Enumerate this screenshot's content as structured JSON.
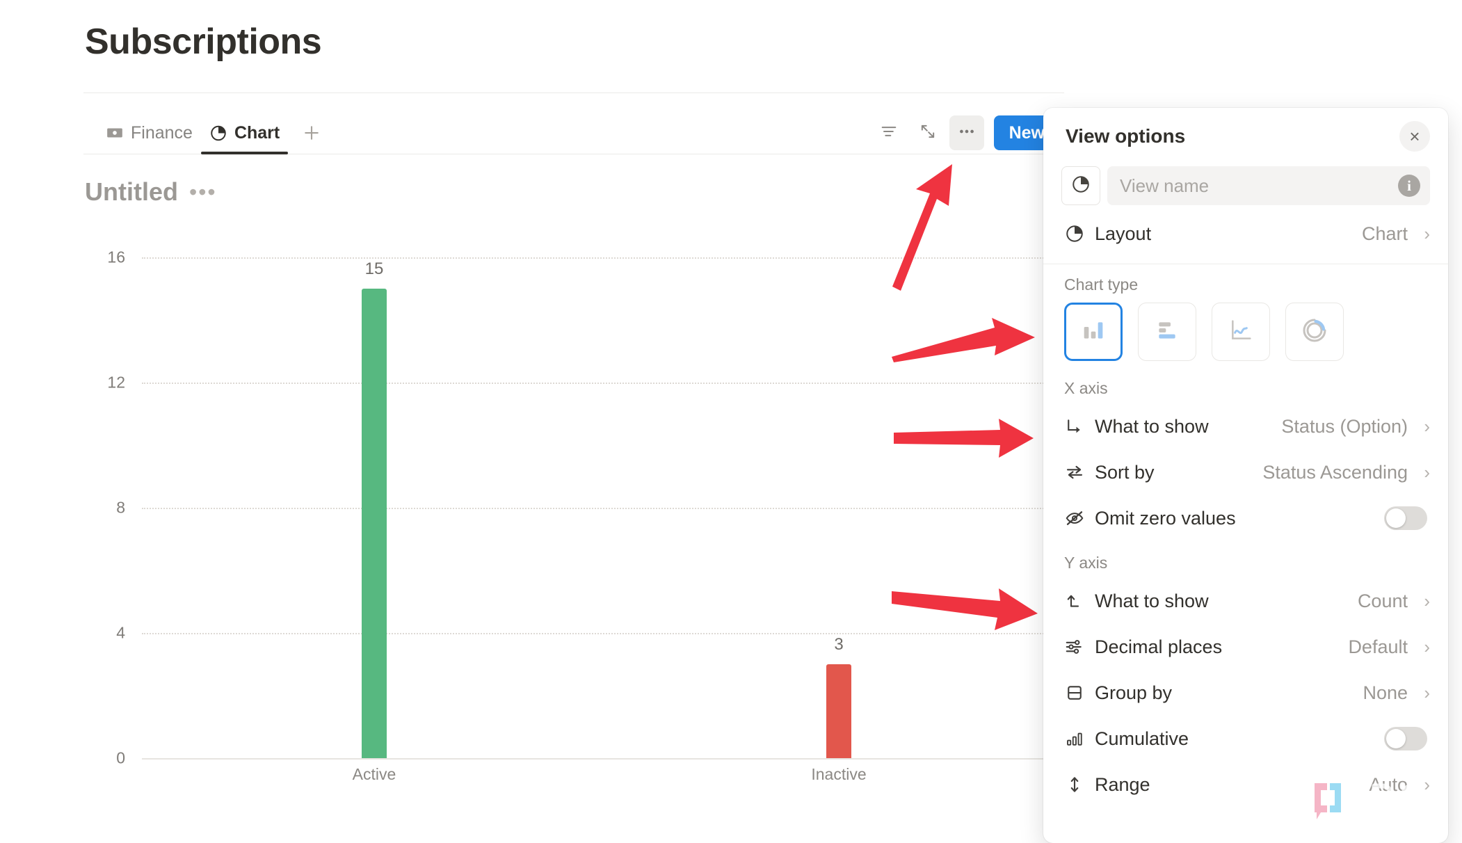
{
  "page": {
    "title": "Subscriptions"
  },
  "tabs": [
    {
      "label": "Finance",
      "icon": "money-icon",
      "active": false
    },
    {
      "label": "Chart",
      "icon": "pie-chart-icon",
      "active": true
    }
  ],
  "tab_add_label": "+",
  "toolbar": {
    "filter_icon": "filter-icon",
    "expand_icon": "expand-icon",
    "more_label": "•••",
    "new_label": "New"
  },
  "chart_block": {
    "title": "Untitled",
    "menu_label": "•••"
  },
  "chart_data": {
    "type": "bar",
    "title": "Untitled",
    "categories": [
      "Active",
      "Inactive"
    ],
    "values": [
      15,
      3
    ],
    "colors": [
      "#57b880",
      "#e2574c"
    ],
    "xlabel": "",
    "ylabel": "",
    "yticks": [
      0,
      4,
      8,
      12,
      16
    ],
    "ylim": [
      0,
      16
    ],
    "grid": true,
    "legend": "none"
  },
  "panel": {
    "title": "View options",
    "close_label": "×",
    "view_name_placeholder": "View name",
    "view_name_value": "",
    "info_label": "i",
    "layout_row": {
      "label": "Layout",
      "value": "Chart",
      "chevron": "›",
      "icon": "pie-chart-icon"
    },
    "chart_type": {
      "section_label": "Chart type",
      "options": [
        {
          "name": "vertical-bar-chart",
          "selected": true
        },
        {
          "name": "horizontal-bar-chart",
          "selected": false
        },
        {
          "name": "line-chart",
          "selected": false
        },
        {
          "name": "donut-chart",
          "selected": false
        }
      ]
    },
    "x_axis": {
      "section_label": "X axis",
      "rows": [
        {
          "label": "What to show",
          "value": "Status (Option)",
          "chevron": "›",
          "icon": "arrow-turn-right-icon",
          "control": "chevron"
        },
        {
          "label": "Sort by",
          "value": "Status Ascending",
          "chevron": "›",
          "icon": "sort-swap-icon",
          "control": "chevron"
        },
        {
          "label": "Omit zero values",
          "value": "",
          "chevron": "",
          "icon": "eye-off-icon",
          "control": "toggle",
          "toggle_on": false
        }
      ]
    },
    "y_axis": {
      "section_label": "Y axis",
      "rows": [
        {
          "label": "What to show",
          "value": "Count",
          "chevron": "›",
          "icon": "arrow-up-axis-icon",
          "control": "chevron"
        },
        {
          "label": "Decimal places",
          "value": "Default",
          "chevron": "›",
          "icon": "sliders-icon",
          "control": "chevron"
        },
        {
          "label": "Group by",
          "value": "None",
          "chevron": "›",
          "icon": "rows-icon",
          "control": "chevron"
        },
        {
          "label": "Cumulative",
          "value": "",
          "chevron": "",
          "icon": "bar-steps-icon",
          "control": "toggle",
          "toggle_on": false
        },
        {
          "label": "Range",
          "value": "Auto",
          "chevron": "›",
          "icon": "updown-arrow-icon",
          "control": "chevron"
        }
      ]
    }
  },
  "annotations": {
    "arrow_color": "#ef3340",
    "arrows": [
      {
        "name": "arrow-to-more-button",
        "direction": "up-right"
      },
      {
        "name": "arrow-to-chart-type",
        "direction": "right"
      },
      {
        "name": "arrow-to-x-axis",
        "direction": "right"
      },
      {
        "name": "arrow-to-y-axis",
        "direction": "right"
      }
    ]
  },
  "watermark": {
    "text": "XDA"
  }
}
